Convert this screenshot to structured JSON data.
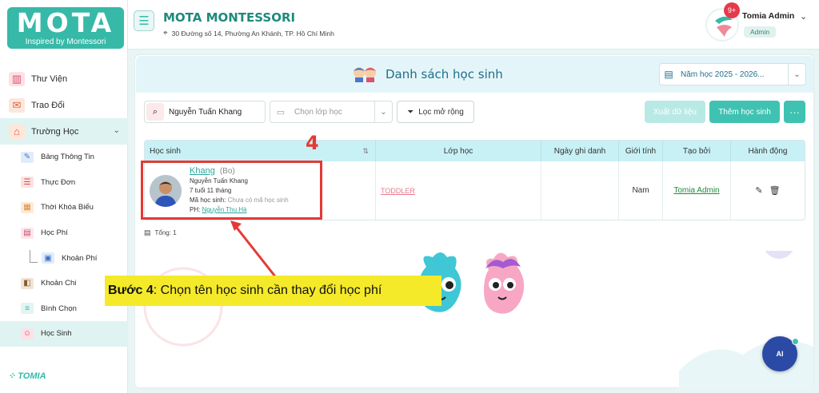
{
  "app": {
    "logo_title": "MOTA",
    "logo_subtitle": "Inspired by Montessori",
    "footer_brand": "TOMIA"
  },
  "sidebar": {
    "items": [
      {
        "label": "Thư Viện",
        "icon": "library-icon"
      },
      {
        "label": "Trao Đổi",
        "icon": "chat-icon"
      },
      {
        "label": "Trường Học",
        "icon": "school-icon"
      }
    ],
    "sub_items": [
      {
        "label": "Bảng Thông Tin",
        "icon": "megaphone-icon"
      },
      {
        "label": "Thực Đơn",
        "icon": "menu-icon"
      },
      {
        "label": "Thời Khóa Biểu",
        "icon": "schedule-icon"
      },
      {
        "label": "Học Phí",
        "icon": "tuition-icon"
      },
      {
        "label": "Khoản Phí",
        "icon": "fee-icon"
      },
      {
        "label": "Khoản Chi",
        "icon": "expense-icon"
      },
      {
        "label": "Bình Chọn",
        "icon": "poll-icon"
      },
      {
        "label": "Học Sinh",
        "icon": "student-icon"
      }
    ]
  },
  "header": {
    "school_name": "MOTA MONTESSORI",
    "address": "30 Đường số 14, Phường An Khánh, TP. Hồ Chí Minh",
    "notification_badge": "9+",
    "user_name": "Tomia Admin",
    "user_role": "Admin"
  },
  "page": {
    "title": "Danh sách học sinh",
    "school_year": "Năm học 2025 - 2026...",
    "search_value": "Nguyễn Tuấn Khang",
    "class_placeholder": "Chọn lớp học",
    "filter_label": "Lọc mở rộng",
    "export_label": "Xuất dữ liệu",
    "add_label": "Thêm học sinh",
    "more_label": "···",
    "total_label": "Tổng: 1"
  },
  "table": {
    "headers": [
      "Học sinh",
      "Lớp học",
      "Ngày ghi danh",
      "Giới tính",
      "Tạo bởi",
      "Hành động"
    ],
    "rows": [
      {
        "name": "Khang",
        "nickname": "(Bo)",
        "full_name": "Nguyễn Tuấn Khang",
        "age": "7 tuổi 11 tháng",
        "code_label": "Mã học sinh:",
        "code_value": "Chưa có mã học sinh",
        "parent_label": "PH:",
        "parent_name": "Nguyễn Thu Hà",
        "class": "TODDLER",
        "enroll_date": "",
        "gender": "Nam",
        "created_by": "Tomia Admin"
      }
    ]
  },
  "annotation": {
    "step_number": "4",
    "step_prefix": "Bước 4",
    "step_text": ": Chọn tên học sinh cần thay đổi học phí"
  },
  "ai_button": {
    "label": "AI"
  },
  "colors": {
    "brand": "#37b9a8",
    "accent": "#3fc2b1",
    "annotation": "#e53935",
    "callout": "#f4ea2a"
  }
}
